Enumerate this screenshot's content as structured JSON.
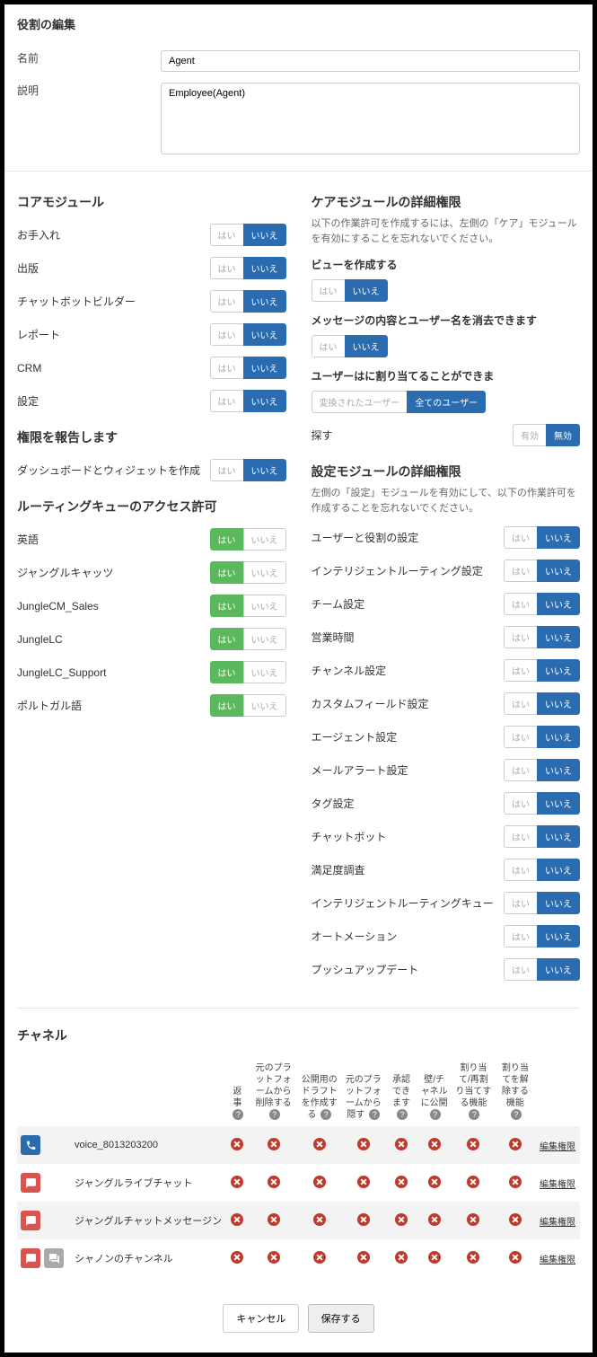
{
  "title": "役割の編集",
  "form": {
    "name_label": "名前",
    "name_value": "Agent",
    "desc_label": "説明",
    "desc_value": "Employee(Agent)"
  },
  "toggle_labels": {
    "yes": "はい",
    "no": "いいえ",
    "enabled": "有効",
    "disabled": "無効"
  },
  "core": {
    "title": "コアモジュール",
    "items": [
      {
        "label": "お手入れ"
      },
      {
        "label": "出版"
      },
      {
        "label": "チャットボットビルダー"
      },
      {
        "label": "レポート"
      },
      {
        "label": "CRM"
      },
      {
        "label": "設定"
      }
    ]
  },
  "report": {
    "title": "権限を報告します",
    "row": {
      "label": "ダッシュボードとウィジェットを作成"
    }
  },
  "routing": {
    "title": "ルーティングキューのアクセス許可",
    "items": [
      {
        "label": "英語"
      },
      {
        "label": "ジャングルキャッツ"
      },
      {
        "label": "JungleCM_Sales"
      },
      {
        "label": "JungleLC"
      },
      {
        "label": "JungleLC_Support"
      },
      {
        "label": "ポルトガル語"
      }
    ]
  },
  "care": {
    "title": "ケアモジュールの詳細権限",
    "note": "以下の作業許可を作成するには、左側の「ケア」モジュールを有効にすることを忘れないでください。",
    "rows": [
      {
        "label": "ビューを作成する",
        "type": "yn"
      },
      {
        "label": "メッセージの内容とユーザー名を消去できます",
        "type": "yn"
      },
      {
        "label": "ユーザーはに割り当てることができま",
        "type": "user",
        "opt_a": "変換されたユーザー",
        "opt_b": "全てのユーザー"
      },
      {
        "label": "探す",
        "type": "ed"
      }
    ]
  },
  "settings": {
    "title": "設定モジュールの詳細権限",
    "note": "左側の「設定」モジュールを有効にして、以下の作業許可を作成することを忘れないでください。",
    "items": [
      {
        "label": "ユーザーと役割の設定"
      },
      {
        "label": "インテリジェントルーティング設定"
      },
      {
        "label": "チーム設定"
      },
      {
        "label": "営業時間"
      },
      {
        "label": "チャンネル設定"
      },
      {
        "label": "カスタムフィールド設定"
      },
      {
        "label": "エージェント設定"
      },
      {
        "label": "メールアラート設定"
      },
      {
        "label": "タグ設定"
      },
      {
        "label": "チャットボット"
      },
      {
        "label": "満足度調査"
      },
      {
        "label": "インテリジェントルーティングキュー"
      },
      {
        "label": "オートメーション"
      },
      {
        "label": "プッシュアップデート"
      }
    ]
  },
  "channels": {
    "title": "チャネル",
    "headers": [
      "返事",
      "元のプラットフォームから削除する",
      "公開用のドラフトを作成する",
      "元のプラットフォームから隠す",
      "承認できます",
      "壁/チャネルに公開",
      "割り当て/再割り当てする機能",
      "割り当てを解除する機能"
    ],
    "edit": "編集権限",
    "rows": [
      {
        "icon": "phone",
        "name": "voice_8013203200"
      },
      {
        "icon": "chat",
        "name": "ジャングルライブチャット"
      },
      {
        "icon": "chat",
        "name": "ジャングルチャットメッセージン"
      },
      {
        "icon": "chat",
        "name": "シャノンのチャンネル",
        "extra": true
      }
    ]
  },
  "footer": {
    "cancel": "キャンセル",
    "save": "保存する"
  }
}
